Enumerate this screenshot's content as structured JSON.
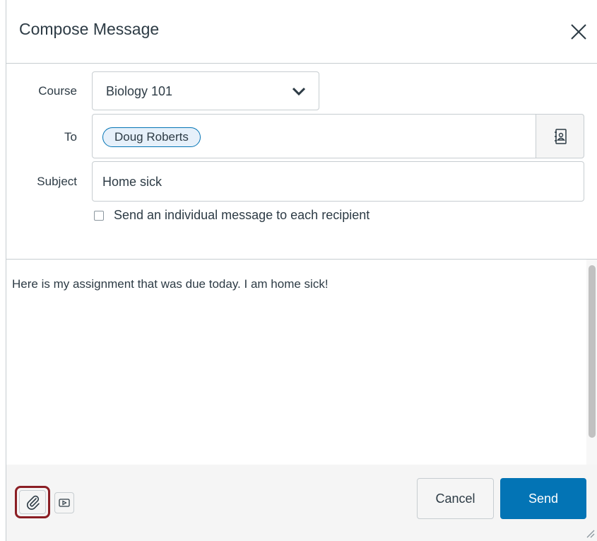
{
  "dialog": {
    "title": "Compose Message",
    "close_icon": "close-icon"
  },
  "form": {
    "course": {
      "label": "Course",
      "value": "Biology 101",
      "icon": "chevron-down-icon"
    },
    "to": {
      "label": "To",
      "recipients": [
        "Doug Roberts"
      ],
      "address_book_icon": "address-book-icon"
    },
    "subject": {
      "label": "Subject",
      "value": "Home sick"
    },
    "individual_message": {
      "label": "Send an individual message to each recipient",
      "checked": false
    }
  },
  "message": {
    "body": "Here is my assignment that was due today. I am home sick!"
  },
  "footer": {
    "attach_icon": "paperclip-icon",
    "media_icon": "media-icon",
    "cancel_label": "Cancel",
    "send_label": "Send"
  },
  "colors": {
    "primary": "#0374b5",
    "highlight_border": "#8b1e24",
    "token_background": "#e6f0fa",
    "text": "#2d3b45",
    "border": "#c7cdd1"
  }
}
